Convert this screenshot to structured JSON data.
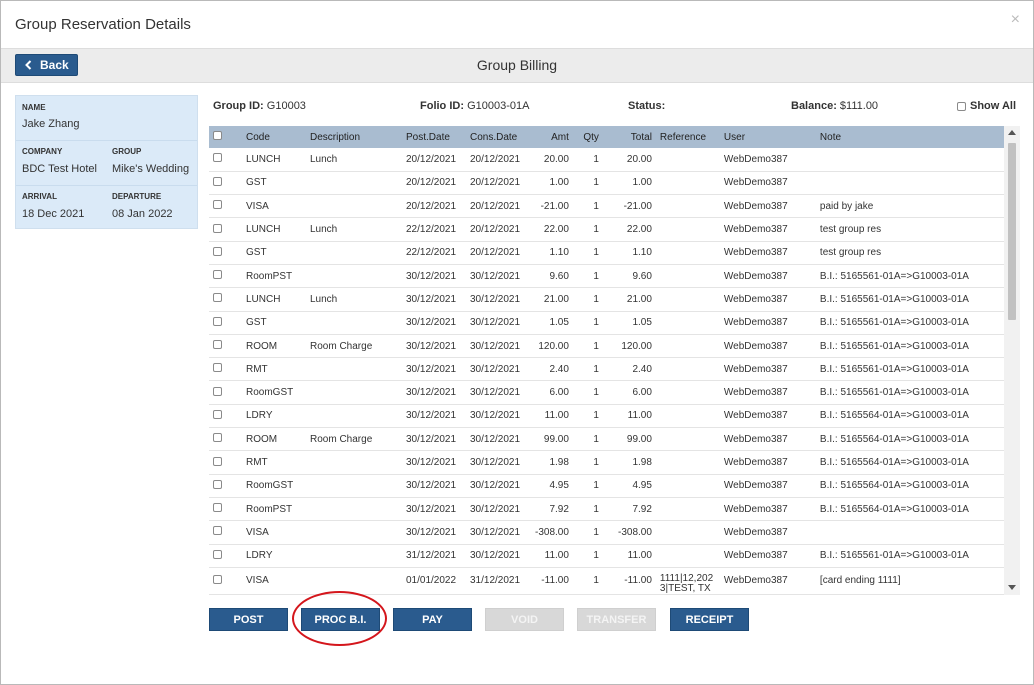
{
  "dialog": {
    "title": "Group Reservation Details",
    "close_glyph": "×"
  },
  "subbar": {
    "back_label": "Back",
    "title": "Group Billing"
  },
  "side": {
    "name_label": "NAME",
    "name": "Jake Zhang",
    "company_label": "COMPANY",
    "company": "BDC Test Hotel",
    "group_label": "GROUP",
    "group": "Mike's Wedding",
    "arrival_label": "ARRIVAL",
    "arrival": "18 Dec 2021",
    "departure_label": "DEPARTURE",
    "departure": "08 Jan 2022"
  },
  "info": {
    "group_id_label": "Group ID:",
    "group_id": "G10003",
    "folio_id_label": "Folio ID:",
    "folio_id": "G10003-01A",
    "status_label": "Status:",
    "status": "",
    "balance_label": "Balance:",
    "balance": "$111.00",
    "show_all_label": "Show All"
  },
  "table": {
    "headers": [
      "Code",
      "Description",
      "Post.Date",
      "Cons.Date",
      "Amt",
      "Qty",
      "Total",
      "Reference",
      "User",
      "Note"
    ],
    "rows": [
      {
        "code": "LUNCH",
        "desc": "Lunch",
        "post": "20/12/2021",
        "cons": "20/12/2021",
        "amt": "20.00",
        "qty": "1",
        "total": "20.00",
        "ref": "",
        "user": "WebDemo387",
        "note": ""
      },
      {
        "code": "GST",
        "desc": "",
        "post": "20/12/2021",
        "cons": "20/12/2021",
        "amt": "1.00",
        "qty": "1",
        "total": "1.00",
        "ref": "",
        "user": "WebDemo387",
        "note": ""
      },
      {
        "code": "VISA",
        "desc": "",
        "post": "20/12/2021",
        "cons": "20/12/2021",
        "amt": "-21.00",
        "qty": "1",
        "total": "-21.00",
        "ref": "",
        "user": "WebDemo387",
        "note": "paid by jake"
      },
      {
        "code": "LUNCH",
        "desc": "Lunch",
        "post": "22/12/2021",
        "cons": "20/12/2021",
        "amt": "22.00",
        "qty": "1",
        "total": "22.00",
        "ref": "",
        "user": "WebDemo387",
        "note": "test group res"
      },
      {
        "code": "GST",
        "desc": "",
        "post": "22/12/2021",
        "cons": "20/12/2021",
        "amt": "1.10",
        "qty": "1",
        "total": "1.10",
        "ref": "",
        "user": "WebDemo387",
        "note": "test group res"
      },
      {
        "code": "RoomPST",
        "desc": "",
        "post": "30/12/2021",
        "cons": "30/12/2021",
        "amt": "9.60",
        "qty": "1",
        "total": "9.60",
        "ref": "",
        "user": "WebDemo387",
        "note": "B.I.: 5165561-01A=>G10003-01A"
      },
      {
        "code": "LUNCH",
        "desc": "Lunch",
        "post": "30/12/2021",
        "cons": "30/12/2021",
        "amt": "21.00",
        "qty": "1",
        "total": "21.00",
        "ref": "",
        "user": "WebDemo387",
        "note": "B.I.: 5165561-01A=>G10003-01A"
      },
      {
        "code": "GST",
        "desc": "",
        "post": "30/12/2021",
        "cons": "30/12/2021",
        "amt": "1.05",
        "qty": "1",
        "total": "1.05",
        "ref": "",
        "user": "WebDemo387",
        "note": "B.I.: 5165561-01A=>G10003-01A"
      },
      {
        "code": "ROOM",
        "desc": "Room Charge",
        "post": "30/12/2021",
        "cons": "30/12/2021",
        "amt": "120.00",
        "qty": "1",
        "total": "120.00",
        "ref": "",
        "user": "WebDemo387",
        "note": "B.I.: 5165561-01A=>G10003-01A"
      },
      {
        "code": "RMT",
        "desc": "",
        "post": "30/12/2021",
        "cons": "30/12/2021",
        "amt": "2.40",
        "qty": "1",
        "total": "2.40",
        "ref": "",
        "user": "WebDemo387",
        "note": "B.I.: 5165561-01A=>G10003-01A"
      },
      {
        "code": "RoomGST",
        "desc": "",
        "post": "30/12/2021",
        "cons": "30/12/2021",
        "amt": "6.00",
        "qty": "1",
        "total": "6.00",
        "ref": "",
        "user": "WebDemo387",
        "note": "B.I.: 5165561-01A=>G10003-01A"
      },
      {
        "code": "LDRY",
        "desc": "",
        "post": "30/12/2021",
        "cons": "30/12/2021",
        "amt": "11.00",
        "qty": "1",
        "total": "11.00",
        "ref": "",
        "user": "WebDemo387",
        "note": "B.I.: 5165564-01A=>G10003-01A"
      },
      {
        "code": "ROOM",
        "desc": "Room Charge",
        "post": "30/12/2021",
        "cons": "30/12/2021",
        "amt": "99.00",
        "qty": "1",
        "total": "99.00",
        "ref": "",
        "user": "WebDemo387",
        "note": "B.I.: 5165564-01A=>G10003-01A"
      },
      {
        "code": "RMT",
        "desc": "",
        "post": "30/12/2021",
        "cons": "30/12/2021",
        "amt": "1.98",
        "qty": "1",
        "total": "1.98",
        "ref": "",
        "user": "WebDemo387",
        "note": "B.I.: 5165564-01A=>G10003-01A"
      },
      {
        "code": "RoomGST",
        "desc": "",
        "post": "30/12/2021",
        "cons": "30/12/2021",
        "amt": "4.95",
        "qty": "1",
        "total": "4.95",
        "ref": "",
        "user": "WebDemo387",
        "note": "B.I.: 5165564-01A=>G10003-01A"
      },
      {
        "code": "RoomPST",
        "desc": "",
        "post": "30/12/2021",
        "cons": "30/12/2021",
        "amt": "7.92",
        "qty": "1",
        "total": "7.92",
        "ref": "",
        "user": "WebDemo387",
        "note": "B.I.: 5165564-01A=>G10003-01A"
      },
      {
        "code": "VISA",
        "desc": "",
        "post": "30/12/2021",
        "cons": "30/12/2021",
        "amt": "-308.00",
        "qty": "1",
        "total": "-308.00",
        "ref": "",
        "user": "WebDemo387",
        "note": ""
      },
      {
        "code": "LDRY",
        "desc": "",
        "post": "31/12/2021",
        "cons": "30/12/2021",
        "amt": "11.00",
        "qty": "1",
        "total": "11.00",
        "ref": "",
        "user": "WebDemo387",
        "note": "B.I.: 5165561-01A=>G10003-01A"
      },
      {
        "code": "VISA",
        "desc": "",
        "post": "01/01/2022",
        "cons": "31/12/2021",
        "amt": "-11.00",
        "qty": "1",
        "total": "-11.00",
        "ref": "1111|12,202 3|TEST, TX",
        "user": "WebDemo387",
        "note": "[card ending 1111]"
      }
    ]
  },
  "actions": {
    "post": "POST",
    "proc_bi": "PROC B.I.",
    "pay": "PAY",
    "void": "VOID",
    "transfer": "TRANSFER",
    "receipt": "RECEIPT"
  },
  "colors": {
    "primary_button": "#2a5b8e",
    "header_row": "#a9bcd0",
    "side_panel": "#dbeaf8",
    "highlight": "#d4161c"
  }
}
